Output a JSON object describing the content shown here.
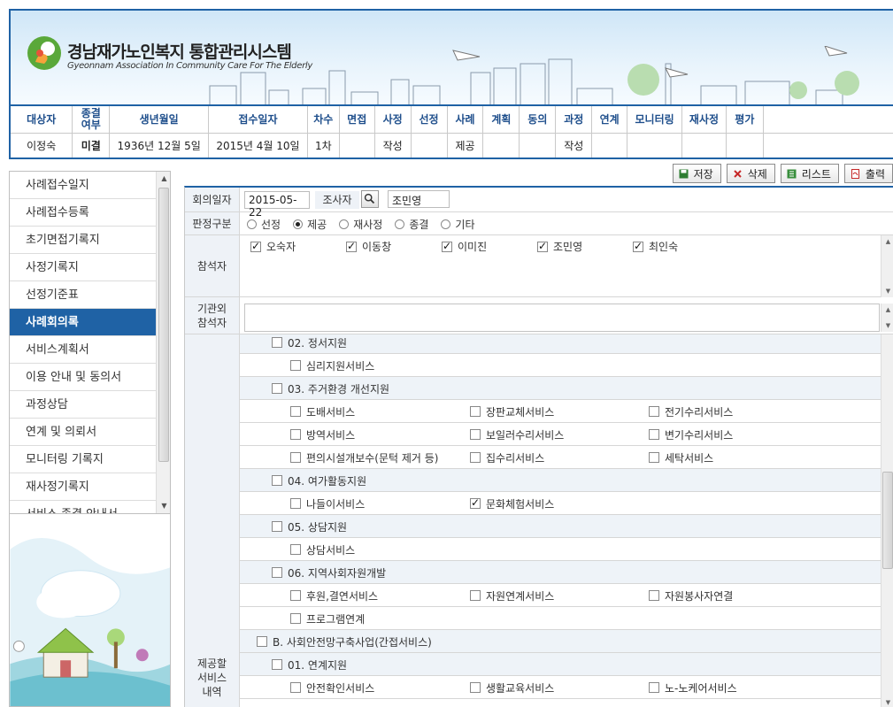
{
  "header": {
    "title_ko": "경남재가노인복지 통합관리시스템",
    "title_en": "Gyeonnam Association In Community Care For The Elderly"
  },
  "info": {
    "columns": [
      "대상자",
      "종결\n여부",
      "생년월일",
      "접수일자",
      "차수",
      "면접",
      "사정",
      "선정",
      "사례",
      "계획",
      "동의",
      "과정",
      "연계",
      "모니터링",
      "재사정",
      "평가"
    ],
    "values": [
      "이정숙",
      "미결",
      "1936년 12월 5일",
      "2015년 4월 10일",
      "1차",
      "",
      "작성",
      "",
      "제공",
      "",
      "",
      "작성",
      "",
      "",
      "",
      ""
    ]
  },
  "toolbar": {
    "save": "저장",
    "delete": "삭제",
    "list": "리스트",
    "print": "출력"
  },
  "sidebar": {
    "items": [
      "사례접수일지",
      "사례접수등록",
      "초기면접기록지",
      "사정기록지",
      "선정기준표",
      "사례회의록",
      "서비스계획서",
      "이용 안내 및 동의서",
      "과정상담",
      "연계 및 의뢰서",
      "모니터링 기록지",
      "재사정기록지",
      "서비스 종결 안내서"
    ],
    "active_index": 5
  },
  "form": {
    "meeting_date_label": "회의일자",
    "meeting_date": "2015-05-22",
    "investigator_label": "조사자",
    "investigator": "조민영",
    "decision_label": "판정구분",
    "decision_options": [
      "선정",
      "제공",
      "재사정",
      "종결",
      "기타"
    ],
    "decision_selected": 1,
    "attendees_label": "참석자",
    "attendees": [
      "오숙자",
      "이동창",
      "이미진",
      "조민영",
      "최인숙"
    ],
    "external_label": "기관외\n참석자",
    "services_label": "제공할\n서비스\n내역"
  },
  "services": [
    {
      "level": 1,
      "items": [
        {
          "label": "02. 정서지원",
          "checked": false
        }
      ]
    },
    {
      "level": 2,
      "items": [
        {
          "label": "심리지원서비스",
          "checked": false
        }
      ]
    },
    {
      "level": 1,
      "items": [
        {
          "label": "03. 주거환경 개선지원",
          "checked": false
        }
      ]
    },
    {
      "level": 2,
      "items": [
        {
          "label": "도배서비스",
          "checked": false
        },
        {
          "label": "장판교체서비스",
          "checked": false
        },
        {
          "label": "전기수리서비스",
          "checked": false
        }
      ]
    },
    {
      "level": 2,
      "items": [
        {
          "label": "방역서비스",
          "checked": false
        },
        {
          "label": "보일러수리서비스",
          "checked": false
        },
        {
          "label": "변기수리서비스",
          "checked": false
        }
      ]
    },
    {
      "level": 2,
      "items": [
        {
          "label": "편의시설개보수(문턱 제거 등)",
          "checked": false
        },
        {
          "label": "집수리서비스",
          "checked": false
        },
        {
          "label": "세탁서비스",
          "checked": false
        }
      ]
    },
    {
      "level": 1,
      "items": [
        {
          "label": "04. 여가활동지원",
          "checked": false
        }
      ]
    },
    {
      "level": 2,
      "items": [
        {
          "label": "나들이서비스",
          "checked": false
        },
        {
          "label": "문화체험서비스",
          "checked": true
        }
      ]
    },
    {
      "level": 1,
      "items": [
        {
          "label": "05. 상담지원",
          "checked": false
        }
      ]
    },
    {
      "level": 2,
      "items": [
        {
          "label": "상담서비스",
          "checked": false
        }
      ]
    },
    {
      "level": 1,
      "items": [
        {
          "label": "06. 지역사회자원개발",
          "checked": false
        }
      ]
    },
    {
      "level": 2,
      "items": [
        {
          "label": "후원,결연서비스",
          "checked": false
        },
        {
          "label": "자원연계서비스",
          "checked": false
        },
        {
          "label": "자원봉사자연결",
          "checked": false
        }
      ]
    },
    {
      "level": 2,
      "items": [
        {
          "label": "프로그램연계",
          "checked": false
        }
      ]
    },
    {
      "level": 0,
      "items": [
        {
          "label": "B. 사회안전망구축사업(간접서비스)",
          "checked": false
        }
      ]
    },
    {
      "level": 1,
      "items": [
        {
          "label": "01. 연계지원",
          "checked": false
        }
      ]
    },
    {
      "level": 2,
      "items": [
        {
          "label": "안전확인서비스",
          "checked": false
        },
        {
          "label": "생활교육서비스",
          "checked": false
        },
        {
          "label": "노-노케어서비스",
          "checked": false
        }
      ]
    }
  ]
}
